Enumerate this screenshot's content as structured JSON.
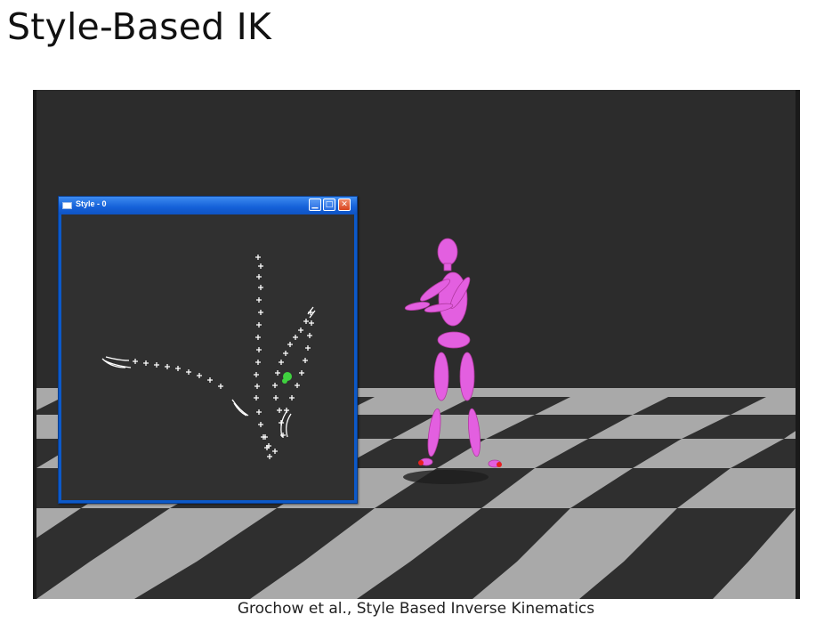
{
  "slide": {
    "title": "Style-Based IK",
    "caption": "Grochow et al., Style Based Inverse Kinematics"
  },
  "style_window": {
    "title": "Style - 0",
    "minimize_glyph": "▁",
    "maximize_glyph": "□",
    "close_glyph": "✕"
  },
  "colors": {
    "figure": "#e35fe0",
    "floor_light": "#a9a9a9",
    "floor_dark": "#2f2f2f",
    "background": "#2c2c2c",
    "latent_points": "#ffffff",
    "current_pose_marker": "#3fd13f",
    "window_frame": "#0c59c9"
  }
}
